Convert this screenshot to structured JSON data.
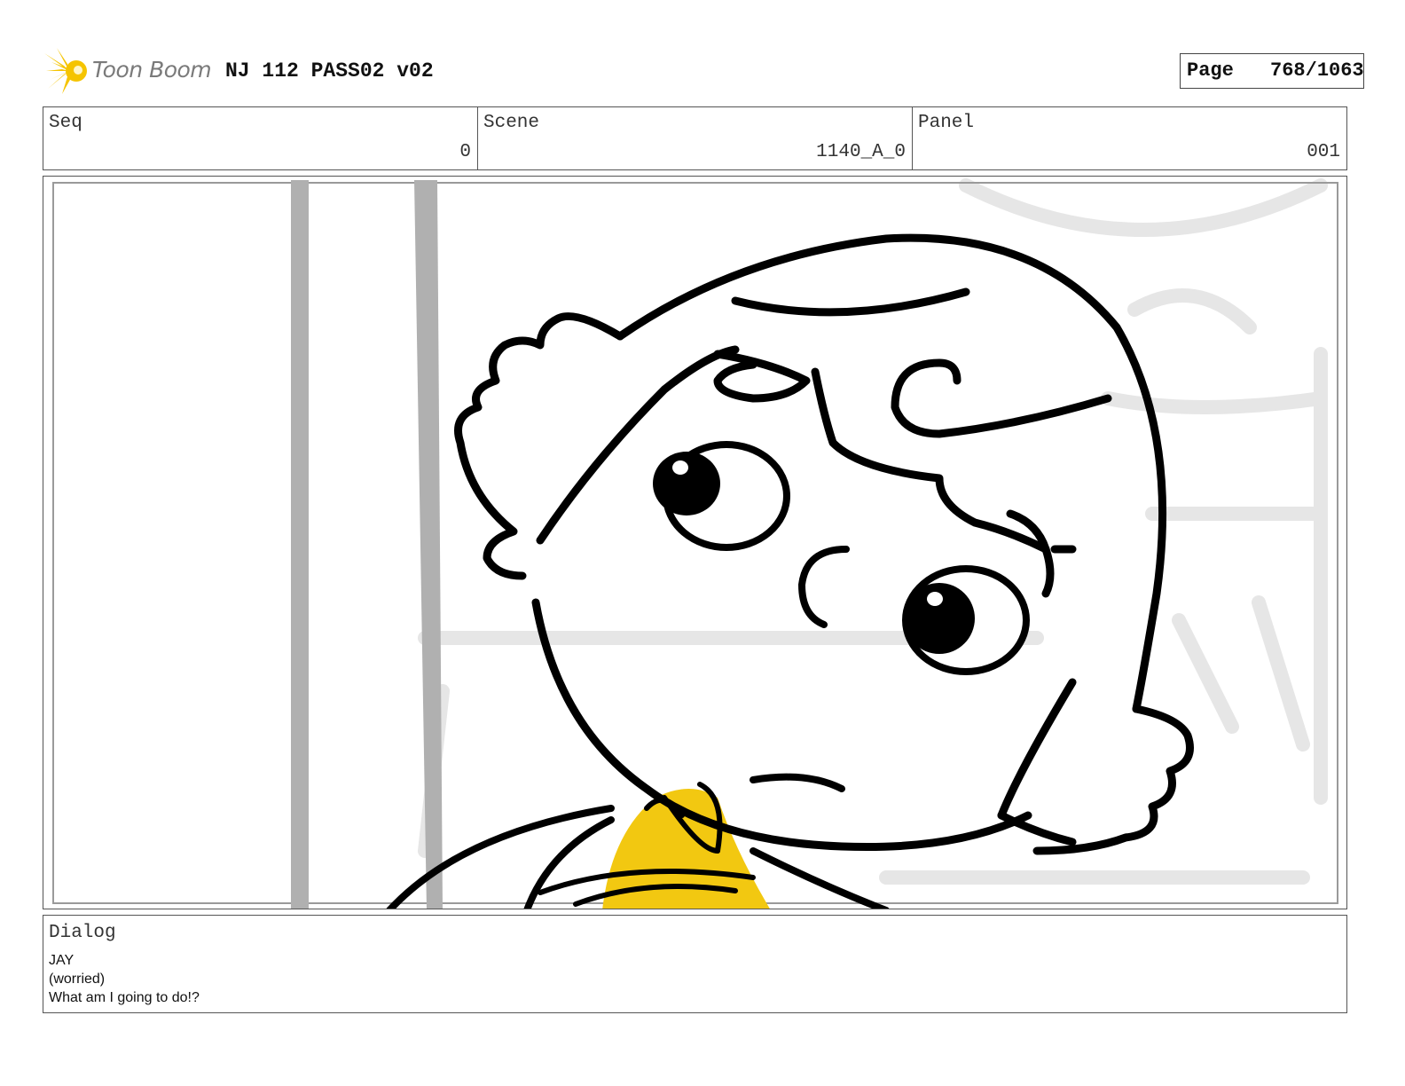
{
  "header": {
    "logo_text": "Toon Boom",
    "project_title": "NJ 112 PASS02 v02",
    "page_label": "Page",
    "page_number": "768/1063"
  },
  "info": {
    "seq_label": "Seq",
    "seq_value": "0",
    "scene_label": "Scene",
    "scene_value": "1140_A_0",
    "panel_label": "Panel",
    "panel_value": "001"
  },
  "dialog": {
    "label": "Dialog",
    "lines": [
      "JAY",
      "(worried)",
      "What am I going to do!?"
    ]
  },
  "colors": {
    "logo_yellow": "#f5c400",
    "scarf_yellow": "#f2c811",
    "pole_gray": "#b0b0b0",
    "border_gray": "#555555"
  }
}
